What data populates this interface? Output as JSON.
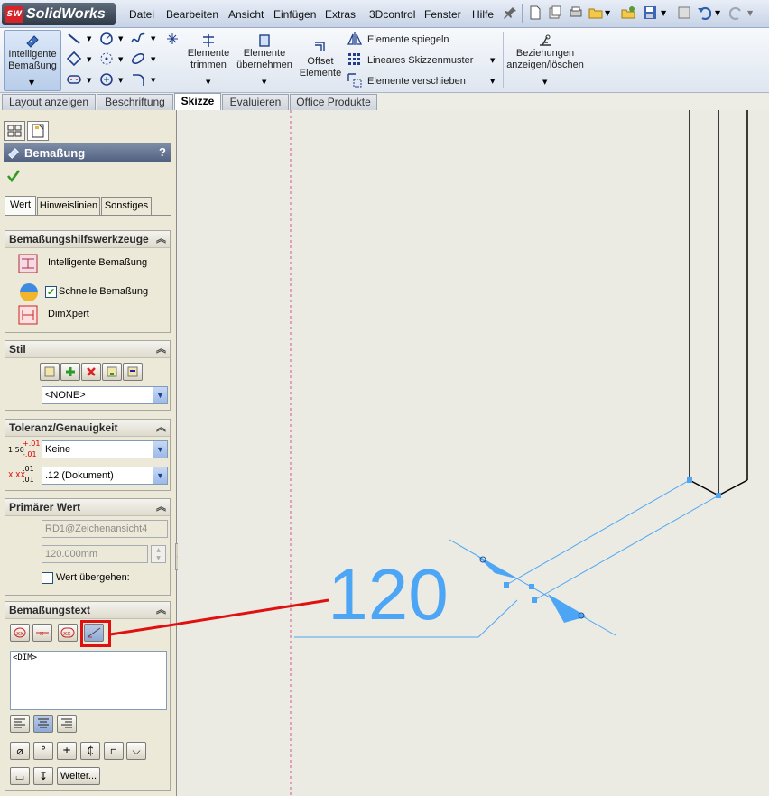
{
  "app": {
    "brand": "SolidWorks",
    "brand_badge": "SW"
  },
  "menu": [
    "Datei",
    "Bearbeiten",
    "Ansicht",
    "Einfügen",
    "Extras",
    "3Dcontrol",
    "Fenster",
    "Hilfe"
  ],
  "ribbon": {
    "smart_dim": "Intelligente Bemaßung",
    "trim": "Elemente trimmen",
    "convert": "Elemente übernehmen",
    "offset": "Offset Elemente",
    "mirror": "Elemente spiegeln",
    "pattern": "Lineares Skizzenmuster",
    "move": "Elemente verschieben",
    "relations": "Beziehungen anzeigen/löschen"
  },
  "cm_tabs": [
    "Layout anzeigen",
    "Beschriftung",
    "Skizze",
    "Evaluieren",
    "Office Produkte"
  ],
  "cm_active": "Skizze",
  "pm": {
    "title": "Bemaßung",
    "help": "?",
    "tabs": [
      "Wert",
      "Hinweislinien",
      "Sonstiges"
    ],
    "tools_group": {
      "title": "Bemaßungshilfswerkzeuge",
      "items": [
        "Intelligente Bemaßung",
        "Schnelle Bemaßung",
        "DimXpert"
      ],
      "quick_checked": true
    },
    "style_group": {
      "title": "Stil",
      "value": "<NONE>"
    },
    "tol_group": {
      "title": "Toleranz/Genauigkeit",
      "tolerance": "Keine",
      "precision": ".12 (Dokument)",
      "tol_icon_main": "1.50",
      "tol_icon_sup": "+.01",
      "tol_icon_sub": "-.01",
      "prec_icon_main": "X.XX",
      "prec_icon_sup": ".01",
      "prec_icon_sub": ".01"
    },
    "primary_group": {
      "title": "Primärer Wert",
      "name": "RD1@Zeichenansicht4",
      "value": "120.000mm",
      "override_label": "Wert übergehen:",
      "override_checked": false
    },
    "text_group": {
      "title": "Bemaßungstext",
      "text": "<DIM>",
      "more": "Weiter..."
    }
  },
  "drawing": {
    "dimension_text": "120"
  },
  "colors": {
    "dimension": "#4da6f5",
    "highlight": "#e01010"
  }
}
